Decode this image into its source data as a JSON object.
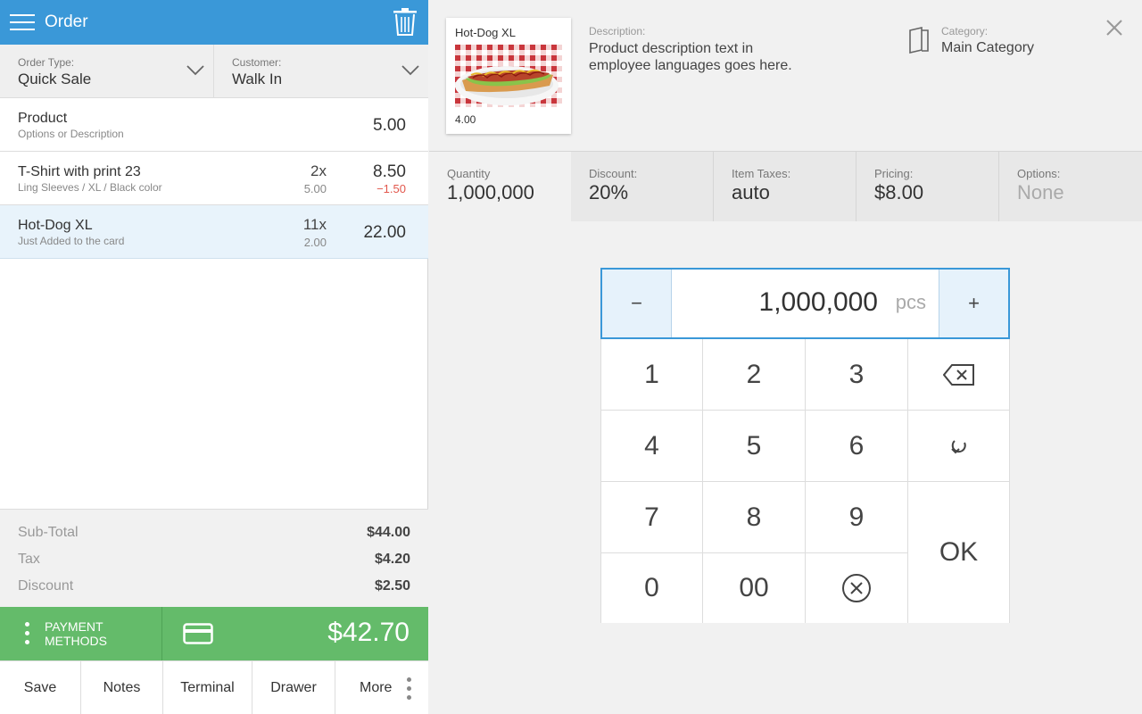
{
  "header": {
    "title": "Order"
  },
  "order_type": {
    "label": "Order Type:",
    "value": "Quick Sale"
  },
  "customer": {
    "label": "Customer:",
    "value": "Walk In"
  },
  "items": [
    {
      "name": "Product",
      "desc": "Options or Description",
      "qty": "",
      "unit": "",
      "price": "5.00",
      "discount": ""
    },
    {
      "name": "T-Shirt with print 23",
      "desc": "Ling Sleeves / XL / Black color",
      "qty": "2x",
      "unit": "5.00",
      "price": "8.50",
      "discount": "−1.50"
    },
    {
      "name": "Hot-Dog XL",
      "desc": "Just Added to the card",
      "qty": "11x",
      "unit": "2.00",
      "price": "22.00",
      "discount": ""
    }
  ],
  "totals": {
    "subtotal_label": "Sub-Total",
    "subtotal": "$44.00",
    "tax_label": "Tax",
    "tax": "$4.20",
    "discount_label": "Discount",
    "discount": "$2.50"
  },
  "payment": {
    "methods_label": "PAYMENT METHODS",
    "total": "$42.70"
  },
  "bottom": {
    "save": "Save",
    "notes": "Notes",
    "terminal": "Terminal",
    "drawer": "Drawer",
    "more": "More"
  },
  "product": {
    "name": "Hot-Dog XL",
    "price": "4.00",
    "description_label": "Description:",
    "description": "Product description text in employee languages goes here.",
    "category_label": "Category:",
    "category": "Main Category"
  },
  "tabs": [
    {
      "label": "Quantity",
      "value": "1,000,000"
    },
    {
      "label": "Discount:",
      "value": "20%"
    },
    {
      "label": "Item Taxes:",
      "value": "auto"
    },
    {
      "label": "Pricing:",
      "value": "$8.00"
    },
    {
      "label": "Options:",
      "value": "None"
    }
  ],
  "quantity": {
    "minus": "−",
    "value": "1,000,000",
    "unit": "pcs",
    "plus": "+"
  },
  "keypad": {
    "k1": "1",
    "k2": "2",
    "k3": "3",
    "k4": "4",
    "k5": "5",
    "k6": "6",
    "k7": "7",
    "k8": "8",
    "k9": "9",
    "k0": "0",
    "k00": "00",
    "ok": "OK"
  },
  "colors": {
    "accent": "#3a98d8",
    "pay": "#64bb6a",
    "discount": "#e2574c",
    "selected_row": "#e8f3fb"
  },
  "icons": [
    "menu-icon",
    "trash-icon",
    "chevron-down-icon",
    "more-vertical-icon",
    "credit-card-icon",
    "book-icon",
    "close-icon",
    "backspace-icon",
    "rotate-icon",
    "clear-circle-icon"
  ]
}
